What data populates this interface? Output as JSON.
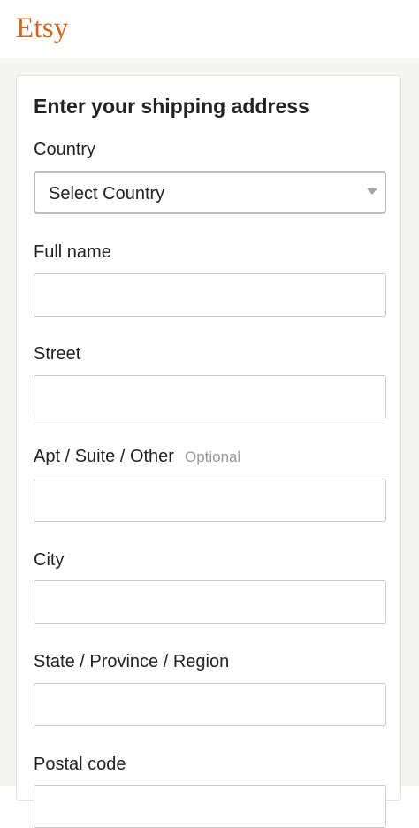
{
  "header": {
    "logo": "Etsy"
  },
  "form": {
    "title": "Enter your shipping address",
    "country": {
      "label": "Country",
      "selected": "Select Country"
    },
    "full_name": {
      "label": "Full name",
      "value": ""
    },
    "street": {
      "label": "Street",
      "value": ""
    },
    "apt": {
      "label": "Apt / Suite / Other",
      "hint": "Optional",
      "value": ""
    },
    "city": {
      "label": "City",
      "value": ""
    },
    "state": {
      "label": "State / Province / Region",
      "value": ""
    },
    "postal": {
      "label": "Postal code",
      "value": ""
    }
  },
  "colors": {
    "brand": "#d5641c",
    "page_background": "#f5f5f1"
  }
}
